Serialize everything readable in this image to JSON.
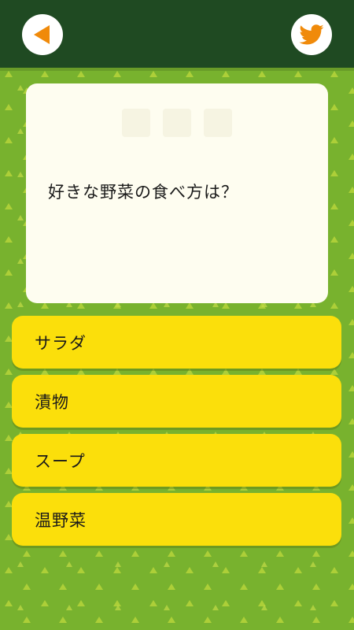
{
  "header": {
    "back_icon": "back-arrow-icon",
    "share_icon": "twitter-bird-icon",
    "bar_color": "#1f4a22",
    "icon_color": "#f08a0a"
  },
  "question": {
    "text": "好きな野菜の食べ方は？"
  },
  "answers": [
    {
      "label": "サラダ"
    },
    {
      "label": "漬物"
    },
    {
      "label": "スープ"
    },
    {
      "label": "温野菜"
    }
  ],
  "colors": {
    "background": "#78b22e",
    "pattern": "#b6d43a",
    "card": "#fefdf0",
    "answer": "#fbdf0b"
  }
}
